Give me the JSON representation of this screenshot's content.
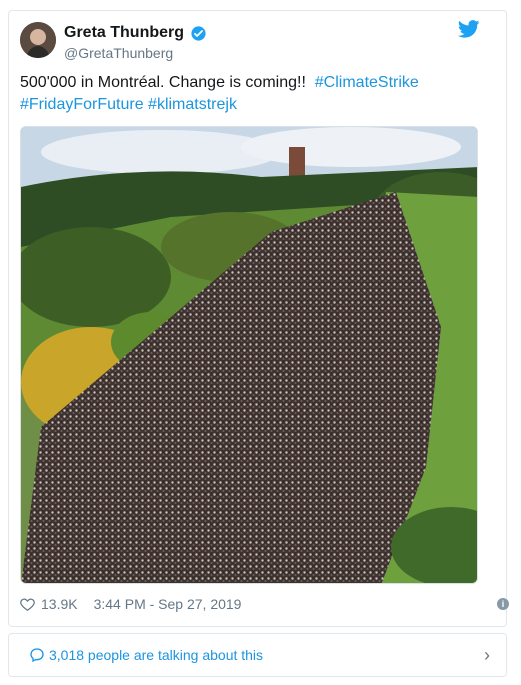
{
  "tweet": {
    "author_name": "Greta Thunberg",
    "handle": "@GretaThunberg",
    "text_part1": "500'000 in Montréal. Change is coming!!",
    "hashtags": [
      "#ClimateStrike",
      "#FridayForFuture",
      "#klimatstrejk"
    ],
    "likes": "13.9K",
    "timestamp": "3:44 PM - Sep 27, 2019"
  },
  "conversation": {
    "label": "3,018 people are talking about this"
  },
  "colors": {
    "accent": "#1b95e0",
    "muted": "#657786",
    "border": "#e1e8ed"
  },
  "icons": {
    "verified": "verified-badge-icon",
    "brand": "twitter-bird-icon",
    "like": "heart-icon",
    "info": "info-icon",
    "reply": "speech-bubble-icon",
    "chevron": "chevron-right-icon"
  }
}
